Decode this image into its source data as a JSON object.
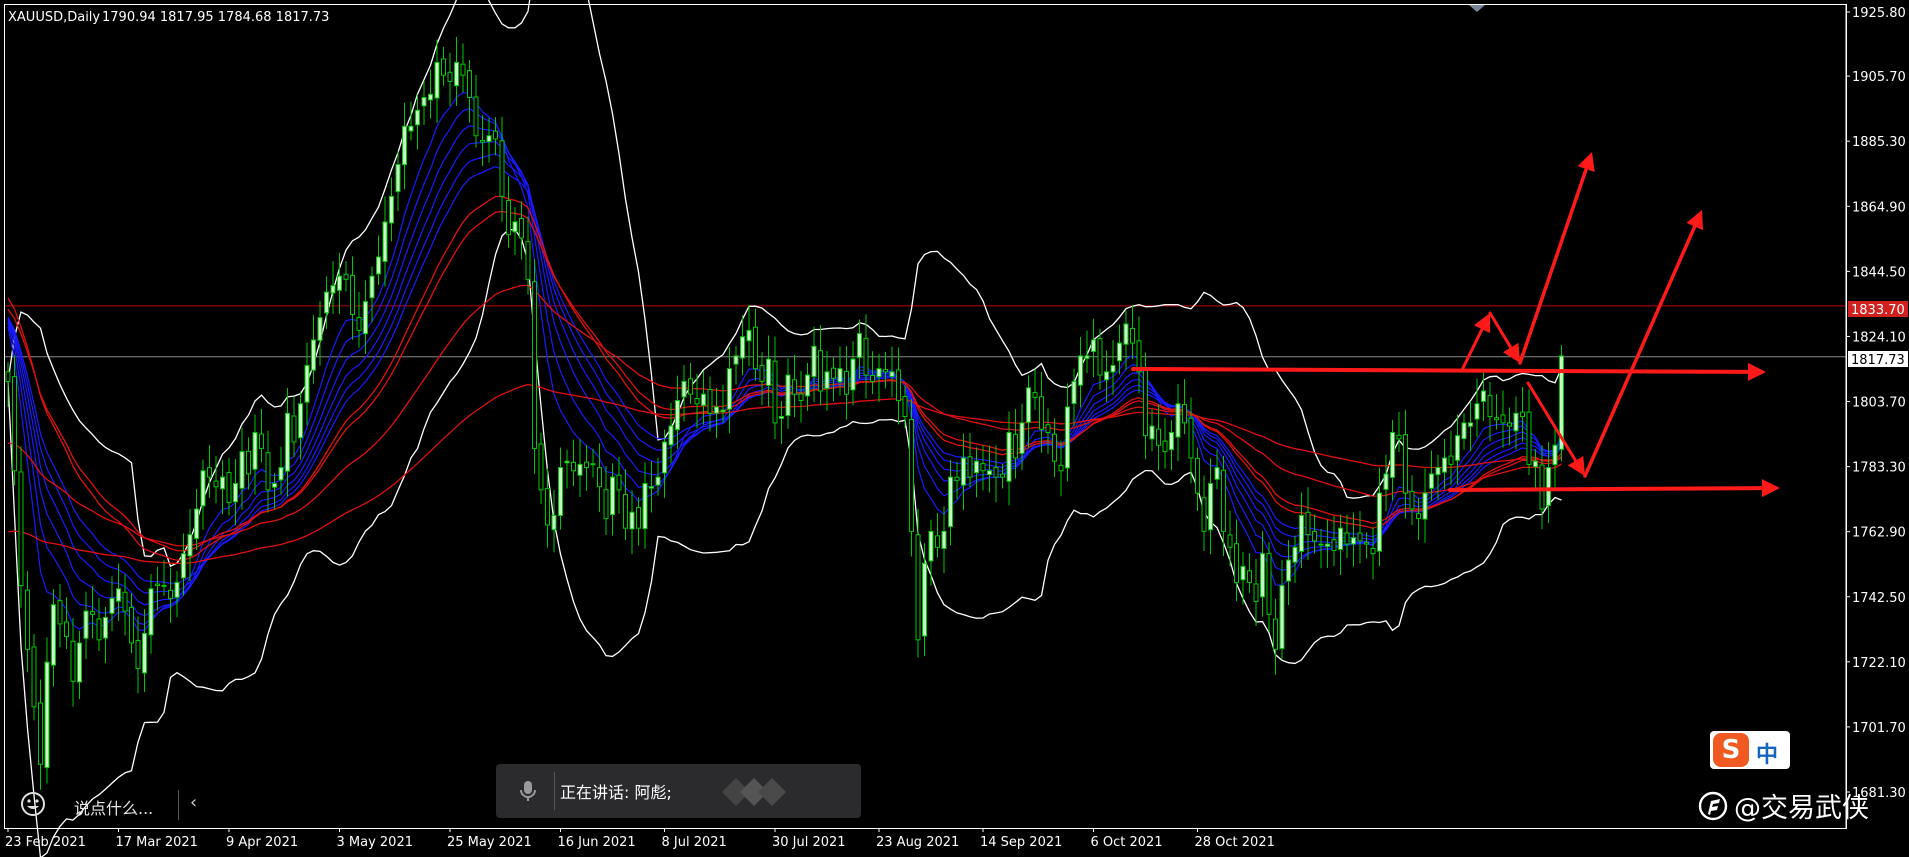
{
  "window": {
    "symbol": "XAUUSD,Daily",
    "ohlc": "1790.94 1817.95 1784.68 1817.73"
  },
  "colors": {
    "background": "#000000",
    "bull_candle": "#c8f5c8",
    "bear_candle": "#00c800",
    "bollinger": "#ffffff",
    "fast_ma": "#1a1aff",
    "slow_ma": "#e01010",
    "annotation": "#ff1a1a",
    "level_line": "#c00000",
    "price_box": "#d02020"
  },
  "chart_data": {
    "type": "candlestick",
    "instrument": "XAUUSD",
    "timeframe": "Daily",
    "x_tick_labels": [
      "23 Feb 2021",
      "17 Mar 2021",
      "9 Apr 2021",
      "3 May 2021",
      "25 May 2021",
      "16 Jun 2021",
      "8 Jul 2021",
      "30 Jul 2021",
      "23 Aug 2021",
      "14 Sep 2021",
      "6 Oct 2021",
      "28 Oct 2021"
    ],
    "y_tick_labels": [
      "1925.80",
      "1905.70",
      "1885.30",
      "1864.90",
      "1844.50",
      "1824.10",
      "1803.70",
      "1783.30",
      "1762.90",
      "1742.50",
      "1722.10",
      "1701.70",
      "1681.30"
    ],
    "ylim": [
      1681.3,
      1925.8
    ],
    "last_price": "1817.73",
    "level_price": "1833.70",
    "closes": [
      1810,
      1782,
      1746,
      1726,
      1708,
      1690,
      1722,
      1740,
      1734,
      1730,
      1716,
      1728,
      1738,
      1737,
      1729,
      1736,
      1742,
      1745,
      1738,
      1728,
      1720,
      1731,
      1745,
      1746,
      1746,
      1742,
      1747,
      1756,
      1762,
      1770,
      1782,
      1780,
      1777,
      1780,
      1772,
      1778,
      1788,
      1781,
      1794,
      1789,
      1776,
      1778,
      1783,
      1800,
      1791,
      1803,
      1815,
      1823,
      1830,
      1838,
      1840,
      1843,
      1842,
      1831,
      1826,
      1835,
      1843,
      1849,
      1860,
      1868,
      1878,
      1890,
      1890,
      1895,
      1899,
      1900,
      1910,
      1906,
      1904,
      1910,
      1906,
      1899,
      1887,
      1885,
      1887,
      1886,
      1868,
      1856,
      1860,
      1855,
      1842,
      1789,
      1776,
      1765,
      1768,
      1783,
      1785,
      1782,
      1784,
      1783,
      1784,
      1777,
      1767,
      1780,
      1776,
      1764,
      1769,
      1764,
      1778,
      1777,
      1780,
      1791,
      1796,
      1804,
      1810,
      1806,
      1803,
      1806,
      1800,
      1802,
      1801,
      1814,
      1818,
      1824,
      1826,
      1814,
      1810,
      1817,
      1797,
      1799,
      1812,
      1806,
      1804,
      1812,
      1821,
      1807,
      1813,
      1811,
      1814,
      1806,
      1817,
      1825,
      1812,
      1810,
      1814,
      1813,
      1813,
      1804,
      1799,
      1763,
      1729,
      1753,
      1763,
      1758,
      1763,
      1780,
      1779,
      1786,
      1780,
      1785,
      1782,
      1782,
      1780,
      1780,
      1794,
      1786,
      1797,
      1808,
      1805,
      1795,
      1794,
      1785,
      1782,
      1802,
      1810,
      1818,
      1818,
      1823,
      1812,
      1813,
      1815,
      1822,
      1828,
      1822,
      1813,
      1793,
      1796,
      1790,
      1788,
      1794,
      1803,
      1797,
      1786,
      1775,
      1763,
      1778,
      1783,
      1763,
      1758,
      1747,
      1752,
      1747,
      1741,
      1756,
      1737,
      1726,
      1746,
      1754,
      1758,
      1768,
      1762,
      1760,
      1759,
      1759,
      1757,
      1764,
      1759,
      1761,
      1760,
      1759,
      1756,
      1775,
      1781,
      1794,
      1792,
      1775,
      1770,
      1767,
      1775,
      1781,
      1783,
      1786,
      1784,
      1793,
      1797,
      1797,
      1803,
      1807,
      1799,
      1798,
      1797,
      1796,
      1800,
      1799,
      1784,
      1785,
      1770,
      1783,
      1790,
      1818
    ]
  },
  "scale": {
    "price_label": "1817.73",
    "level_label": "1833.70"
  },
  "voice_overlay": {
    "mic_icon": "microphone-icon",
    "speaking_label": "正在讲话: 阿彪;"
  },
  "chat_bar": {
    "emoji_icon": "emoji-icon",
    "placeholder": "说点什么...",
    "collapse_icon": "chevron-left-icon",
    "collapse_glyph": "‹"
  },
  "ime": {
    "logo": "S",
    "mode": "中"
  },
  "watermark": {
    "text": "@交易武侠"
  }
}
